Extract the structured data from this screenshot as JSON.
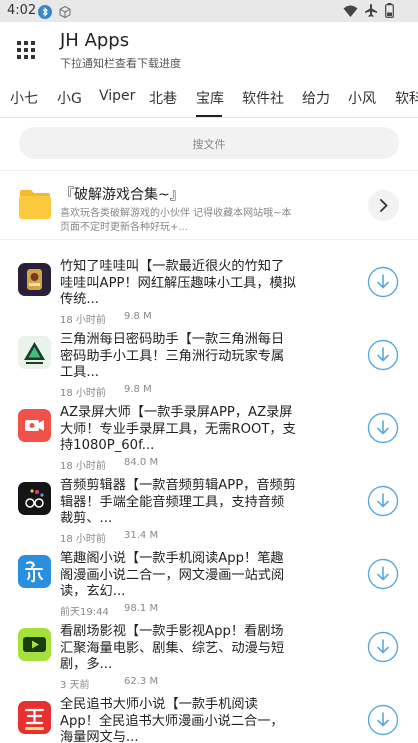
{
  "status_bar": {
    "time": "4:02"
  },
  "app_bar": {
    "title": "JH Apps",
    "subtitle": "下拉通知栏查看下载进度"
  },
  "tabs": [
    {
      "label": "小七",
      "active": false
    },
    {
      "label": "小G",
      "active": false
    },
    {
      "label": "Viper",
      "active": false
    },
    {
      "label": "北巷",
      "active": false
    },
    {
      "label": "宝库",
      "active": true
    },
    {
      "label": "软件社",
      "active": false
    },
    {
      "label": "给力",
      "active": false
    },
    {
      "label": "小风",
      "active": false
    },
    {
      "label": "软科",
      "active": false
    }
  ],
  "search": {
    "placeholder": "搜文件"
  },
  "collection": {
    "title": "『破解游戏合集~』",
    "description": "喜欢玩各类破解游戏的小伙伴 记得收藏本网站哦~本页面不定时更新各种好玩+..."
  },
  "items": [
    {
      "icon": "zhizhidaowajiao-icon",
      "title": "竹知了哇哇叫【一款最近很火的竹知了哇哇叫APP！网红解压趣味小工具，模拟传统...",
      "time": "18 小时前",
      "size": "9.8 M"
    },
    {
      "icon": "triangle-password-icon",
      "title": "三角洲每日密码助手【一款三角洲每日密码助手小工具！三角洲行动玩家专属工具...",
      "time": "18 小时前",
      "size": "9.8 M"
    },
    {
      "icon": "screen-recorder-icon",
      "title": "AZ录屏大师【一款手录屏APP，AZ录屏大师！专业手录屏工具，无需ROOT，支持1080P_60f...",
      "time": "18 小时前",
      "size": "84.0 M"
    },
    {
      "icon": "audio-editor-icon",
      "title": "音频剪辑器【一款音频剪辑APP，音频剪辑器！手端全能音频理工具，支持音频裁剪、...",
      "time": "18 小时前",
      "size": "31.4 M"
    },
    {
      "icon": "biquge-reader-icon",
      "title": "笔趣阁小说【一款手机阅读App！笔趣阁漫画小说二合一，网文漫画一站式阅读，玄幻...",
      "time": "前天19:44",
      "size": "98.1 M"
    },
    {
      "icon": "aikan-video-icon",
      "title": "看剧场影视【一款手影视App！看剧场汇聚海量电影、剧集、综艺、动漫与短剧，多...",
      "time": "3 天前",
      "size": "62.3 M"
    },
    {
      "icon": "quanmin-reader-icon",
      "title": "全民追书大师小说【一款手机阅读App！全民追书大师漫画小说二合一，海量网文与...",
      "time": "",
      "size": ""
    }
  ],
  "colors": {
    "accent": "#5aa8dd",
    "status_bar_bg": "#e8e8e8",
    "tab_indicator": "#222222"
  }
}
